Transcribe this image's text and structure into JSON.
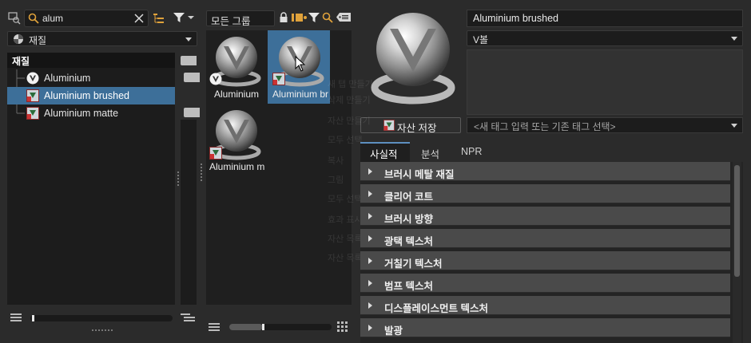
{
  "left_panel": {
    "search_value": "alum",
    "category_dropdown": "재질",
    "tree_header": "재질",
    "tree_items": [
      {
        "label": "Aluminium",
        "selected": false
      },
      {
        "label": "Aluminium brushed",
        "selected": true
      },
      {
        "label": "Aluminium matte",
        "selected": false
      }
    ]
  },
  "middle_panel": {
    "group_dropdown": "모든 그룹",
    "thumbnails": [
      {
        "label": "Aluminium",
        "selected": false
      },
      {
        "label": "Aluminium br",
        "selected": true
      },
      {
        "label": "Aluminium m",
        "selected": false
      }
    ]
  },
  "right_panel": {
    "asset_name": "Aluminium brushed",
    "preview_type": "V볼",
    "save_button_label": "자산 저장",
    "tag_placeholder": "<새 태그 입력 또는 기존 태그 선택>",
    "tabs": [
      {
        "label": "사실적",
        "active": true
      },
      {
        "label": "분석",
        "active": false
      },
      {
        "label": "NPR",
        "active": false
      }
    ],
    "sections": [
      "브러시 메탈 재질",
      "클리어 코트",
      "브러시 방향",
      "광택 텍스처",
      "거칠기 텍스처",
      "범프 텍스처",
      "디스플레이스먼트 텍스처",
      "발광"
    ]
  },
  "colors": {
    "selection": "#3d6f99",
    "background": "#2b2b2b",
    "panel": "#1c1c1c",
    "section_bar": "#4a4a4a"
  }
}
